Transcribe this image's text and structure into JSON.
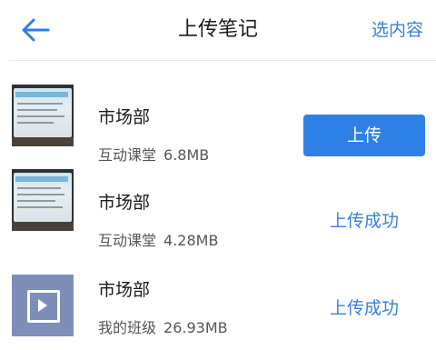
{
  "header": {
    "title": "上传笔记",
    "select_label": "选内容",
    "back_icon": "back-arrow-icon"
  },
  "colors": {
    "accent": "#2f80e6",
    "link": "#3a7fd6",
    "text": "#1a1a1a",
    "meta": "#555555"
  },
  "items": [
    {
      "name": "市场部",
      "category": "互动课堂",
      "size": "6.8MB",
      "thumb": "screen-photo",
      "action": "上传",
      "action_type": "button"
    },
    {
      "name": "市场部",
      "category": "互动课堂",
      "size": "4.28MB",
      "thumb": "screen-photo",
      "action": "上传成功",
      "action_type": "status"
    },
    {
      "name": "市场部",
      "category": "我的班级",
      "size": "26.93MB",
      "thumb": "video-icon",
      "action": "上传成功",
      "action_type": "status"
    }
  ]
}
